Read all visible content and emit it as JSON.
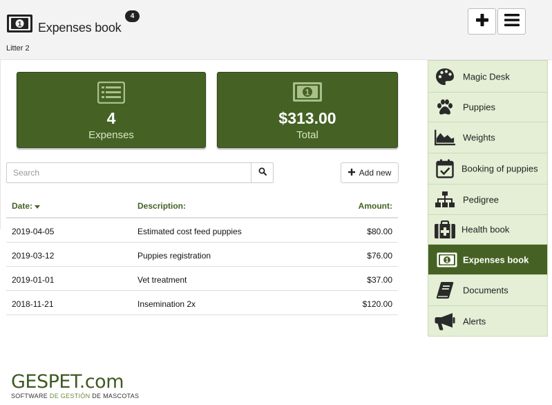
{
  "header": {
    "title": "Expenses book",
    "badge": "4",
    "subtitle": "Litter 2",
    "icon": "money-bill-icon",
    "actions": {
      "add_icon": "plus-icon",
      "menu_icon": "hamburger-menu-icon"
    }
  },
  "cards": {
    "expenses": {
      "icon": "list-icon",
      "value": "4",
      "label": "Expenses"
    },
    "total": {
      "icon": "money-bill-icon",
      "value": "$313.00",
      "label": "Total"
    }
  },
  "search": {
    "placeholder": "Search",
    "value": "",
    "button_icon": "search-icon"
  },
  "add_new": {
    "label": "Add new",
    "icon": "plus-icon"
  },
  "table": {
    "headers": {
      "date": "Date:",
      "description": "Description:",
      "amount": "Amount:"
    },
    "sort": {
      "column": "date",
      "direction": "desc",
      "icon": "caret-down-icon"
    },
    "rows": [
      {
        "date": "2019-04-05",
        "description": "Estimated cost feed puppies",
        "amount": "$80.00"
      },
      {
        "date": "2019-03-12",
        "description": "Puppies registration",
        "amount": "$76.00"
      },
      {
        "date": "2019-01-01",
        "description": "Vet treatment",
        "amount": "$37.00"
      },
      {
        "date": "2018-11-21",
        "description": "Insemination 2x",
        "amount": "$120.00"
      }
    ]
  },
  "sidebar": {
    "items": [
      {
        "label": "Magic Desk",
        "icon": "palette-icon",
        "active": false
      },
      {
        "label": "Puppies",
        "icon": "paw-icon",
        "active": false
      },
      {
        "label": "Weights",
        "icon": "area-chart-icon",
        "active": false
      },
      {
        "label": "Booking of puppies",
        "icon": "calendar-check-icon",
        "active": false
      },
      {
        "label": "Pedigree",
        "icon": "sitemap-icon",
        "active": false
      },
      {
        "label": "Health book",
        "icon": "medkit-icon",
        "active": false
      },
      {
        "label": "Expenses book",
        "icon": "money-bill-icon",
        "active": true
      },
      {
        "label": "Documents",
        "icon": "book-icon",
        "active": false
      },
      {
        "label": "Alerts",
        "icon": "bullhorn-icon",
        "active": false
      }
    ]
  },
  "logo": {
    "brand": "GESPET.com",
    "tagline_part1": "SOFTWARE",
    "tagline_part2": "DE GESTIÓN",
    "tagline_part3": "DE MASCOTAS"
  },
  "colors": {
    "primary": "#456224",
    "sidebar_bg": "#e4efd6",
    "header_bg": "#f3f3f3",
    "card_label": "#d8e6c4"
  }
}
